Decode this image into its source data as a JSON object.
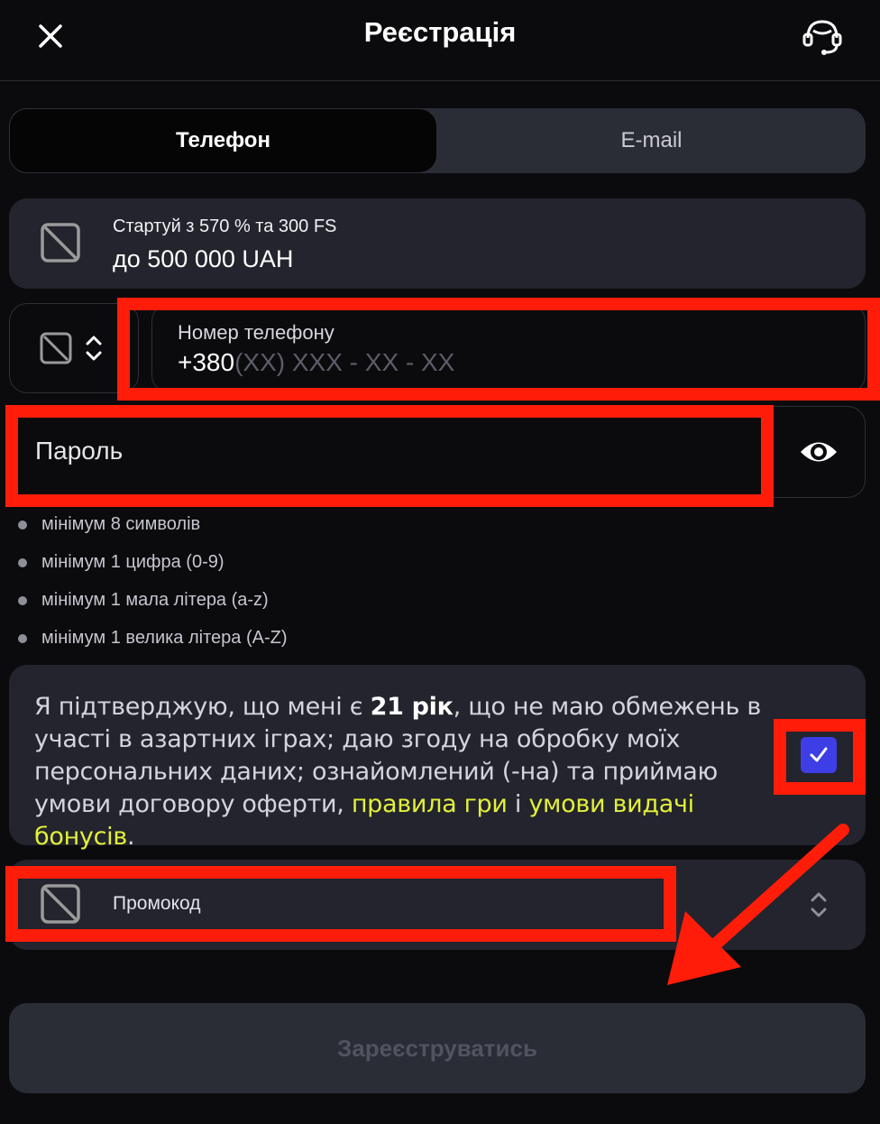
{
  "header": {
    "title": "Реєстрація",
    "close_icon": "close-icon",
    "support_icon": "headset-support-icon"
  },
  "tabs": [
    {
      "label": "Телефон",
      "active": true
    },
    {
      "label": "E-mail",
      "active": false
    }
  ],
  "bonus": {
    "line1": "Стартуй з 570 % та 300 FS",
    "line2": "до 500 000 UAH",
    "icon": "image-placeholder-icon"
  },
  "phone": {
    "country_icon": "image-placeholder-icon",
    "label": "Номер телефону",
    "prefix": "+380",
    "mask": "(XX) XXX - XX - XX"
  },
  "password": {
    "placeholder": "Пароль",
    "toggle_icon": "eye-icon"
  },
  "requirements": [
    "мінімум 8 символів",
    "мінімум 1 цифра (0-9)",
    "мінімум 1 мала літера (a-z)",
    "мінімум 1 велика літера (A-Z)"
  ],
  "consent": {
    "text_before": "Я підтверджую, що мені є ",
    "age": "21 рік",
    "text_middle": ", що не маю обмежень в участі в азартних іграх; даю згоду на обробку моїх персональних даних; ознайомлений (-на) та приймаю умови договору оферти, ",
    "link_rules": "правила гри",
    "and": " і ",
    "link_bonus": "умови видачі бонусів",
    "end": ".",
    "checked": true
  },
  "promo": {
    "label": "Промокод",
    "icon": "image-placeholder-icon"
  },
  "submit": {
    "label": "Зареєструватись",
    "enabled": false
  },
  "colors": {
    "background": "#0b0b0d",
    "card": "#23242d",
    "accent_checkbox": "#3d3ee6",
    "link": "#e3f03a",
    "highlight": "#ff1d0a"
  }
}
